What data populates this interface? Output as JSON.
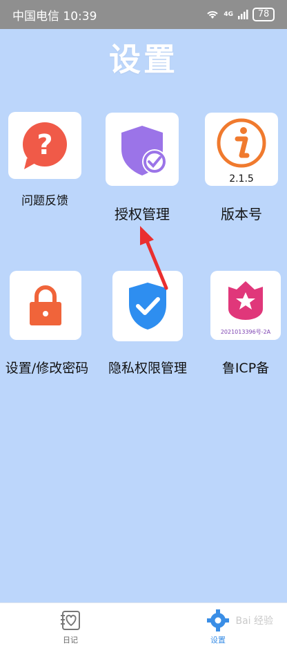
{
  "status_bar": {
    "carrier_time": "中国电信 10:39",
    "network": "4G",
    "battery": "78"
  },
  "page": {
    "title": "设置"
  },
  "grid": {
    "feedback": {
      "label": "问题反馈"
    },
    "authorization": {
      "label": "授权管理"
    },
    "version": {
      "label": "版本号",
      "value": "2.1.5"
    },
    "password": {
      "label": "设置/修改密码"
    },
    "privacy": {
      "label": "隐私权限管理"
    },
    "icp": {
      "label": "鲁ICP备",
      "number": "2021013396号-2A"
    }
  },
  "tabbar": {
    "diary": {
      "label": "日记"
    },
    "settings": {
      "label": "设置"
    }
  },
  "watermark": {
    "text": "Bai 经验"
  },
  "colors": {
    "background": "#bcd6fb",
    "statusbar": "#8f8f8f",
    "feedback_red": "#f05a48",
    "auth_purple": "#9b74e8",
    "info_orange": "#f07a2e",
    "lock_orange": "#f0643a",
    "shield_blue": "#2e8ef0",
    "icp_pink": "#e0377a",
    "arrow_red": "#ea2f2f",
    "tab_active": "#3a8ee6"
  }
}
